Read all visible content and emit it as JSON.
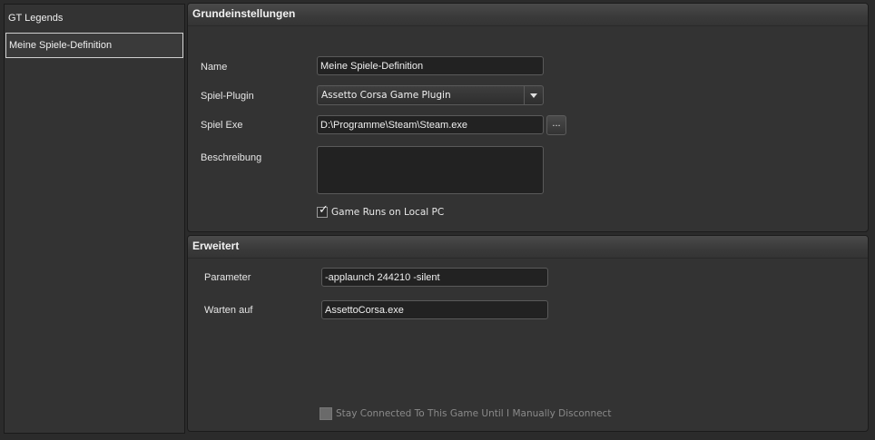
{
  "sidebar": {
    "items": [
      {
        "label": "GT Legends",
        "selected": false
      },
      {
        "label": "Meine Spiele-Definition",
        "selected": true
      }
    ]
  },
  "basic": {
    "title": "Grundeinstellungen",
    "name_label": "Name",
    "name_value": "Meine Spiele-Definition",
    "plugin_label": "Spiel-Plugin",
    "plugin_value": "Assetto Corsa Game Plugin",
    "exe_label": "Spiel Exe",
    "exe_value": "D:\\Programme\\Steam\\Steam.exe",
    "browse_label": "...",
    "description_label": "Beschreibung",
    "description_value": "",
    "local_pc_label": "Game Runs on Local PC",
    "local_pc_checked": true
  },
  "advanced": {
    "title": "Erweitert",
    "parameter_label": "Parameter",
    "parameter_value": "-applaunch 244210 -silent",
    "wait_label": "Warten auf",
    "wait_value": "AssettoCorsa.exe",
    "stay_connected_label": "Stay Connected To This Game Until I Manually Disconnect",
    "stay_connected_checked": false,
    "stay_connected_enabled": false
  }
}
